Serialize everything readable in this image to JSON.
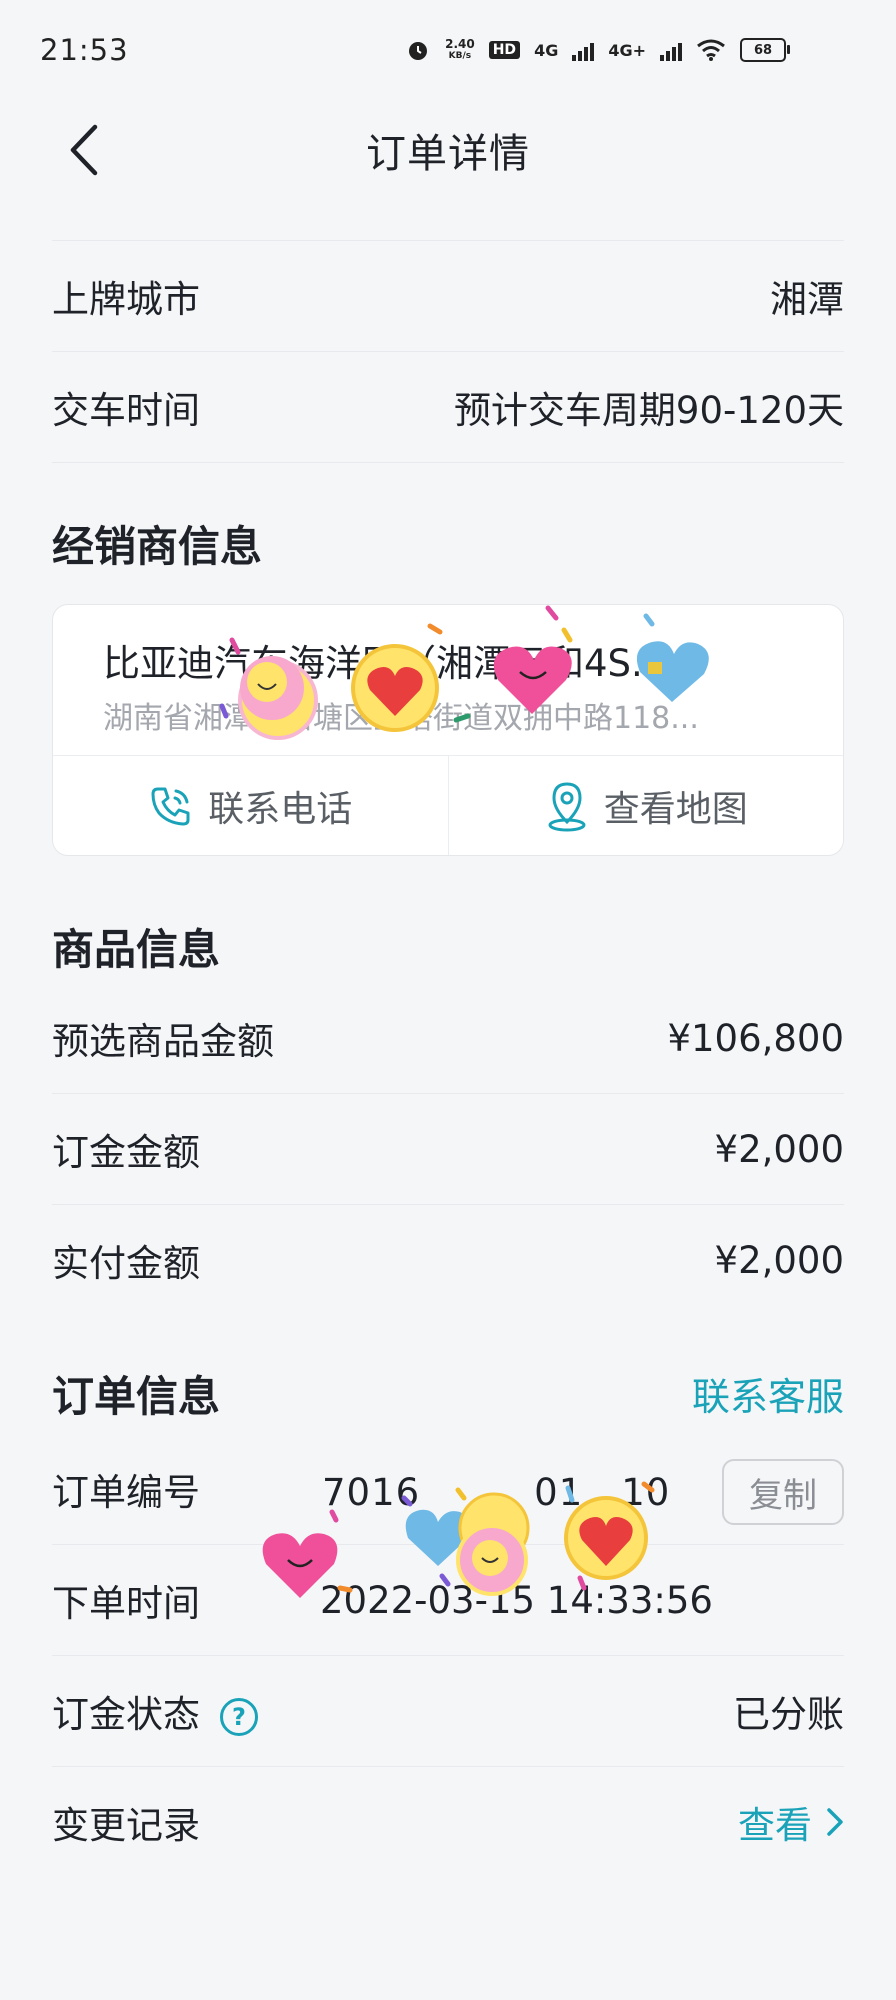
{
  "status_bar": {
    "time": "21:53",
    "net_speed": "2.40",
    "net_unit": "KB/s",
    "hd_tag": "HD",
    "sim1": "4G",
    "sim2": "4G+",
    "battery": "68"
  },
  "header": {
    "title": "订单详情",
    "back_icon": "chevron-left-icon"
  },
  "car_info": {
    "rows": [
      {
        "label": "上牌城市",
        "value": "湘潭"
      },
      {
        "label": "交车时间",
        "value": "预计交车周期90-120天"
      }
    ]
  },
  "dealer": {
    "section_title": "经销商信息",
    "name": "比亚迪汽车海洋网（湘潭元和4S...",
    "address": "湖南省湘潭市岳塘区宝塔街道双拥中路118...",
    "call_label": "联系电话",
    "map_label": "查看地图",
    "call_icon": "phone-icon",
    "map_icon": "map-pin-icon"
  },
  "goods": {
    "section_title": "商品信息",
    "rows": [
      {
        "label": "预选商品金额",
        "value": "¥106,800"
      },
      {
        "label": "订金金额",
        "value": "¥2,000"
      },
      {
        "label": "实付金额",
        "value": "¥2,000"
      }
    ]
  },
  "order": {
    "section_title": "订单信息",
    "service_link": "联系客服",
    "order_no_label": "订单编号",
    "order_no_value": "7016　　　01　10",
    "copy_label": "复制",
    "time_label": "下单时间",
    "time_value": "2022-03-15 14:33:56",
    "deposit_status_label": "订金状态",
    "deposit_status_value": "已分账",
    "help_icon": "question-circle-icon",
    "change_label": "变更记录",
    "change_link": "查看",
    "chevron_icon": "chevron-right-icon"
  },
  "colors": {
    "accent": "#1aa3b8",
    "text": "#1f2329",
    "muted": "#a4a7ad",
    "background": "#f5f6f8"
  }
}
